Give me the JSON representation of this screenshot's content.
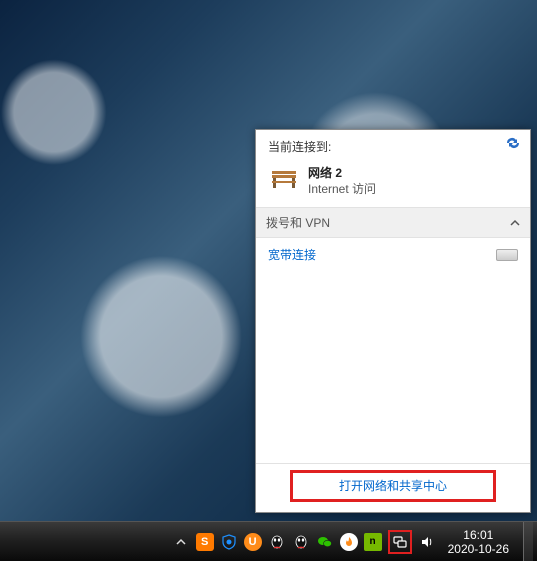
{
  "flyout": {
    "header": "当前连接到:",
    "network": {
      "name": "网络  2",
      "status": "Internet 访问"
    },
    "section_label": "拨号和 VPN",
    "broadband_label": "宽带连接",
    "footer_link": "打开网络和共享中心"
  },
  "taskbar": {
    "sogou": "S",
    "uc": "U",
    "nvidia": "n",
    "time": "16:01",
    "date": "2020-10-26"
  }
}
